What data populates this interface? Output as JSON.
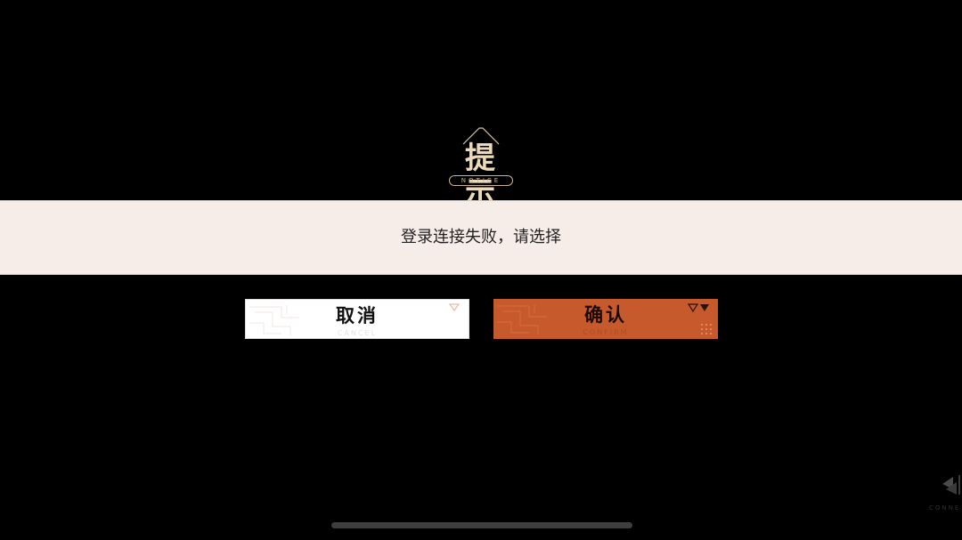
{
  "dialog": {
    "title": "提 示",
    "title_subtitle": "NOTICE",
    "message": "登录连接失败，请选择"
  },
  "buttons": {
    "cancel": {
      "label": "取消",
      "sublabel": "CANCEL"
    },
    "confirm": {
      "label": "确认",
      "sublabel": "CONFIRM"
    }
  },
  "edge_badge": {
    "text": "CONNE"
  },
  "colors": {
    "background": "#000000",
    "title_gold": "#ecd9b8",
    "banner": "#f6ece8",
    "confirm_orange": "#c75a2c",
    "cancel_white": "#ffffff"
  }
}
